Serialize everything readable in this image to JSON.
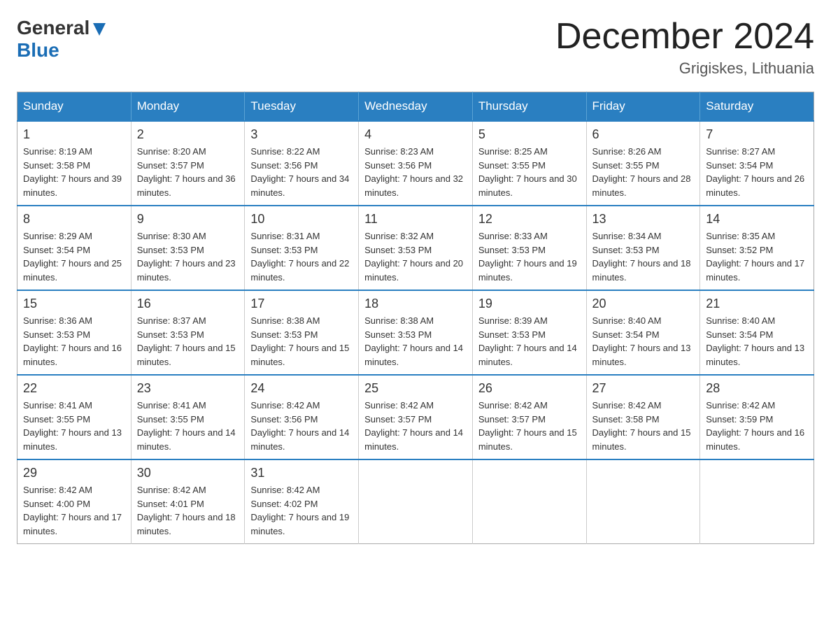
{
  "header": {
    "logo_general": "General",
    "logo_blue": "Blue",
    "title": "December 2024",
    "subtitle": "Grigiskes, Lithuania"
  },
  "calendar": {
    "headers": [
      "Sunday",
      "Monday",
      "Tuesday",
      "Wednesday",
      "Thursday",
      "Friday",
      "Saturday"
    ],
    "weeks": [
      [
        {
          "day": "1",
          "sunrise": "Sunrise: 8:19 AM",
          "sunset": "Sunset: 3:58 PM",
          "daylight": "Daylight: 7 hours and 39 minutes."
        },
        {
          "day": "2",
          "sunrise": "Sunrise: 8:20 AM",
          "sunset": "Sunset: 3:57 PM",
          "daylight": "Daylight: 7 hours and 36 minutes."
        },
        {
          "day": "3",
          "sunrise": "Sunrise: 8:22 AM",
          "sunset": "Sunset: 3:56 PM",
          "daylight": "Daylight: 7 hours and 34 minutes."
        },
        {
          "day": "4",
          "sunrise": "Sunrise: 8:23 AM",
          "sunset": "Sunset: 3:56 PM",
          "daylight": "Daylight: 7 hours and 32 minutes."
        },
        {
          "day": "5",
          "sunrise": "Sunrise: 8:25 AM",
          "sunset": "Sunset: 3:55 PM",
          "daylight": "Daylight: 7 hours and 30 minutes."
        },
        {
          "day": "6",
          "sunrise": "Sunrise: 8:26 AM",
          "sunset": "Sunset: 3:55 PM",
          "daylight": "Daylight: 7 hours and 28 minutes."
        },
        {
          "day": "7",
          "sunrise": "Sunrise: 8:27 AM",
          "sunset": "Sunset: 3:54 PM",
          "daylight": "Daylight: 7 hours and 26 minutes."
        }
      ],
      [
        {
          "day": "8",
          "sunrise": "Sunrise: 8:29 AM",
          "sunset": "Sunset: 3:54 PM",
          "daylight": "Daylight: 7 hours and 25 minutes."
        },
        {
          "day": "9",
          "sunrise": "Sunrise: 8:30 AM",
          "sunset": "Sunset: 3:53 PM",
          "daylight": "Daylight: 7 hours and 23 minutes."
        },
        {
          "day": "10",
          "sunrise": "Sunrise: 8:31 AM",
          "sunset": "Sunset: 3:53 PM",
          "daylight": "Daylight: 7 hours and 22 minutes."
        },
        {
          "day": "11",
          "sunrise": "Sunrise: 8:32 AM",
          "sunset": "Sunset: 3:53 PM",
          "daylight": "Daylight: 7 hours and 20 minutes."
        },
        {
          "day": "12",
          "sunrise": "Sunrise: 8:33 AM",
          "sunset": "Sunset: 3:53 PM",
          "daylight": "Daylight: 7 hours and 19 minutes."
        },
        {
          "day": "13",
          "sunrise": "Sunrise: 8:34 AM",
          "sunset": "Sunset: 3:53 PM",
          "daylight": "Daylight: 7 hours and 18 minutes."
        },
        {
          "day": "14",
          "sunrise": "Sunrise: 8:35 AM",
          "sunset": "Sunset: 3:52 PM",
          "daylight": "Daylight: 7 hours and 17 minutes."
        }
      ],
      [
        {
          "day": "15",
          "sunrise": "Sunrise: 8:36 AM",
          "sunset": "Sunset: 3:53 PM",
          "daylight": "Daylight: 7 hours and 16 minutes."
        },
        {
          "day": "16",
          "sunrise": "Sunrise: 8:37 AM",
          "sunset": "Sunset: 3:53 PM",
          "daylight": "Daylight: 7 hours and 15 minutes."
        },
        {
          "day": "17",
          "sunrise": "Sunrise: 8:38 AM",
          "sunset": "Sunset: 3:53 PM",
          "daylight": "Daylight: 7 hours and 15 minutes."
        },
        {
          "day": "18",
          "sunrise": "Sunrise: 8:38 AM",
          "sunset": "Sunset: 3:53 PM",
          "daylight": "Daylight: 7 hours and 14 minutes."
        },
        {
          "day": "19",
          "sunrise": "Sunrise: 8:39 AM",
          "sunset": "Sunset: 3:53 PM",
          "daylight": "Daylight: 7 hours and 14 minutes."
        },
        {
          "day": "20",
          "sunrise": "Sunrise: 8:40 AM",
          "sunset": "Sunset: 3:54 PM",
          "daylight": "Daylight: 7 hours and 13 minutes."
        },
        {
          "day": "21",
          "sunrise": "Sunrise: 8:40 AM",
          "sunset": "Sunset: 3:54 PM",
          "daylight": "Daylight: 7 hours and 13 minutes."
        }
      ],
      [
        {
          "day": "22",
          "sunrise": "Sunrise: 8:41 AM",
          "sunset": "Sunset: 3:55 PM",
          "daylight": "Daylight: 7 hours and 13 minutes."
        },
        {
          "day": "23",
          "sunrise": "Sunrise: 8:41 AM",
          "sunset": "Sunset: 3:55 PM",
          "daylight": "Daylight: 7 hours and 14 minutes."
        },
        {
          "day": "24",
          "sunrise": "Sunrise: 8:42 AM",
          "sunset": "Sunset: 3:56 PM",
          "daylight": "Daylight: 7 hours and 14 minutes."
        },
        {
          "day": "25",
          "sunrise": "Sunrise: 8:42 AM",
          "sunset": "Sunset: 3:57 PM",
          "daylight": "Daylight: 7 hours and 14 minutes."
        },
        {
          "day": "26",
          "sunrise": "Sunrise: 8:42 AM",
          "sunset": "Sunset: 3:57 PM",
          "daylight": "Daylight: 7 hours and 15 minutes."
        },
        {
          "day": "27",
          "sunrise": "Sunrise: 8:42 AM",
          "sunset": "Sunset: 3:58 PM",
          "daylight": "Daylight: 7 hours and 15 minutes."
        },
        {
          "day": "28",
          "sunrise": "Sunrise: 8:42 AM",
          "sunset": "Sunset: 3:59 PM",
          "daylight": "Daylight: 7 hours and 16 minutes."
        }
      ],
      [
        {
          "day": "29",
          "sunrise": "Sunrise: 8:42 AM",
          "sunset": "Sunset: 4:00 PM",
          "daylight": "Daylight: 7 hours and 17 minutes."
        },
        {
          "day": "30",
          "sunrise": "Sunrise: 8:42 AM",
          "sunset": "Sunset: 4:01 PM",
          "daylight": "Daylight: 7 hours and 18 minutes."
        },
        {
          "day": "31",
          "sunrise": "Sunrise: 8:42 AM",
          "sunset": "Sunset: 4:02 PM",
          "daylight": "Daylight: 7 hours and 19 minutes."
        },
        null,
        null,
        null,
        null
      ]
    ]
  }
}
